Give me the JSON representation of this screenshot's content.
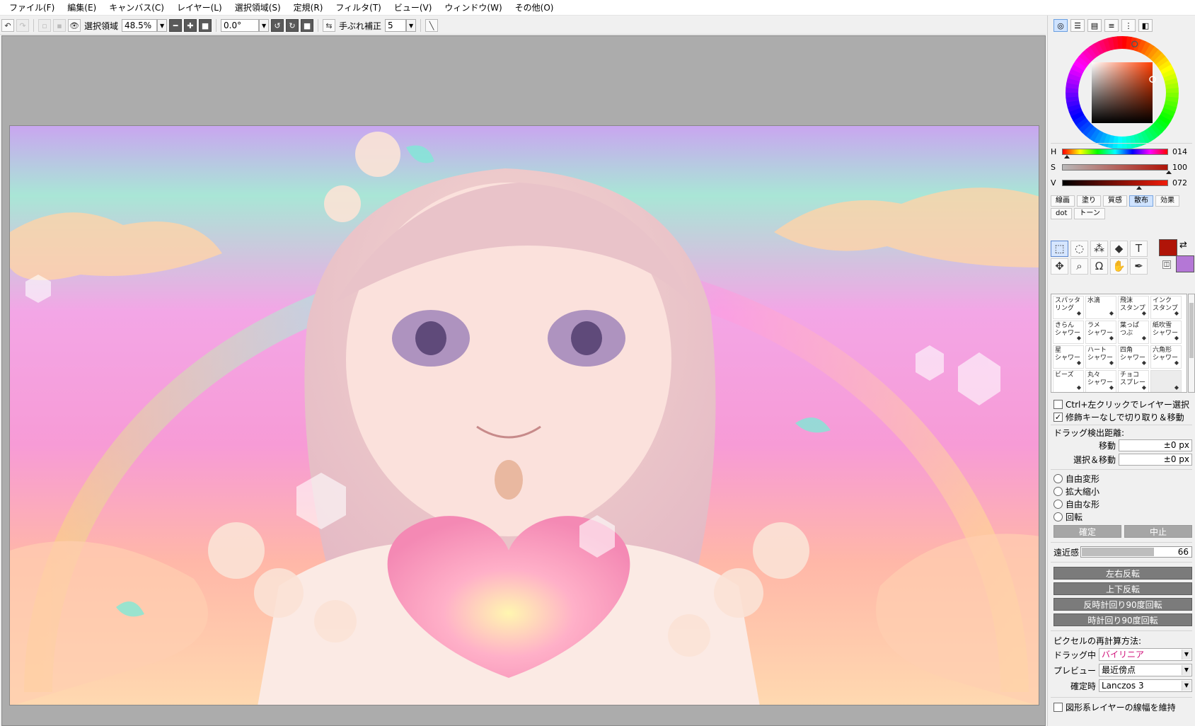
{
  "menu": [
    "ファイル(F)",
    "編集(E)",
    "キャンバス(C)",
    "レイヤー(L)",
    "選択領域(S)",
    "定規(R)",
    "フィルタ(T)",
    "ビュー(V)",
    "ウィンドウ(W)",
    "その他(O)"
  ],
  "toolbar": {
    "selection_label": "選択領域",
    "zoom": "48.5%",
    "rotation": "0.0°",
    "stabilizer_label": "手ぶれ補正",
    "stabilizer_value": "5"
  },
  "color": {
    "h_label": "H",
    "h_value": "014",
    "s_label": "S",
    "s_value": "100",
    "v_label": "V",
    "v_value": "072",
    "hue_fraction": 0.04,
    "sat_fraction": 1.0,
    "val_fraction": 0.72,
    "main": "#b01408",
    "sub": "#b477d6"
  },
  "brush_tabs_row1": [
    "線画",
    "塗り",
    "質感",
    "散布",
    "効果"
  ],
  "brush_tabs_row2": [
    "dot",
    "トーン"
  ],
  "brush_active_tab": "散布",
  "brushes": [
    "スパッタ\nリング",
    "水滴",
    "飛沫\nスタンプ",
    "インク\nスタンプ",
    "きらん\nシャワー",
    "ラメ\nシャワー",
    "葉っぱ\nつぶ",
    "紙吹雪\nシャワー",
    "星\nシャワー",
    "ハート\nシャワー",
    "四角\nシャワー",
    "六角形\nシャワー",
    "ビーズ",
    "丸々\nシャワー",
    "チョコ\nスプレー",
    ""
  ],
  "options": {
    "ctrl_click": "Ctrl+左クリックでレイヤー選択",
    "modifier": "修飾キーなしで切り取り＆移動",
    "drag_detect": "ドラッグ検出距離:",
    "move_label": "移動",
    "move_value": "±0 px",
    "selmove_label": "選択＆移動",
    "selmove_value": "±0 px",
    "transforms": [
      "自由変形",
      "拡大縮小",
      "自由な形",
      "回転"
    ],
    "confirm": "確定",
    "cancel": "中止",
    "perspective_label": "遠近感",
    "perspective_value": "66",
    "perspective_fraction": 0.66,
    "flip_h": "左右反転",
    "flip_v": "上下反転",
    "rot_ccw": "反時計回り90度回転",
    "rot_cw": "時計回り90度回転",
    "resample_label": "ピクセルの再計算方法:",
    "dragging_label": "ドラッグ中",
    "dragging_value": "バイリニア",
    "preview_label": "プレビュー",
    "preview_value": "最近傍点",
    "commit_label": "確定時",
    "commit_value": "Lanczos 3",
    "keep_stroke": "図形系レイヤーの線幅を維持"
  }
}
